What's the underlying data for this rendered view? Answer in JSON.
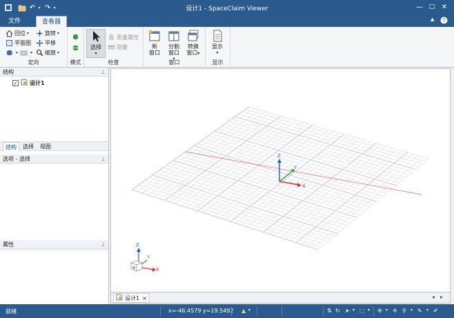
{
  "window": {
    "title": "设计1 - SpaceClaim Viewer",
    "controls": {
      "minimize": "—",
      "maximize": "□",
      "close": "✕"
    }
  },
  "ribbon": {
    "tabs": [
      {
        "label": "文件"
      },
      {
        "label": "查看器"
      }
    ],
    "groups": {
      "orient": {
        "label": "定向",
        "home": "回位",
        "plan": "平面图",
        "rotate": "旋转",
        "pan": "平移",
        "zoom": "缩放"
      },
      "mode": {
        "label": "模式"
      },
      "inspect": {
        "label": "检查",
        "select": "选择",
        "mass_props": "质量属性",
        "measure": "测量"
      },
      "window": {
        "label": "窗口",
        "new_window": [
          "新",
          "窗口"
        ],
        "split": [
          "分割",
          "窗口"
        ],
        "switch": [
          "转换",
          "窗口"
        ]
      },
      "display": {
        "label": "显示",
        "show": "显示"
      }
    }
  },
  "panels": {
    "structure": {
      "title": "结构",
      "tree_item": "设计1"
    },
    "panel_tabs": [
      {
        "label": "结构"
      },
      {
        "label": "选择"
      },
      {
        "label": "视图"
      }
    ],
    "options": {
      "title": "选项 - 选择"
    },
    "properties": {
      "title": "属性"
    }
  },
  "viewport": {
    "axes": {
      "x": "X",
      "y": "Y",
      "z": "Z"
    },
    "doc_tab": "设计1",
    "doc_tab_close": "×",
    "scroll_left": "◂",
    "scroll_right": "▸"
  },
  "statusbar": {
    "status": "就绪",
    "coordinates": "x=-46.4579  y=19.5492"
  },
  "colors": {
    "titlebar": "#2b5b8e",
    "axis_x": "#e4262e",
    "axis_y": "#2fa43a",
    "axis_z": "#2463c4",
    "grid": "#b9b9d8"
  }
}
